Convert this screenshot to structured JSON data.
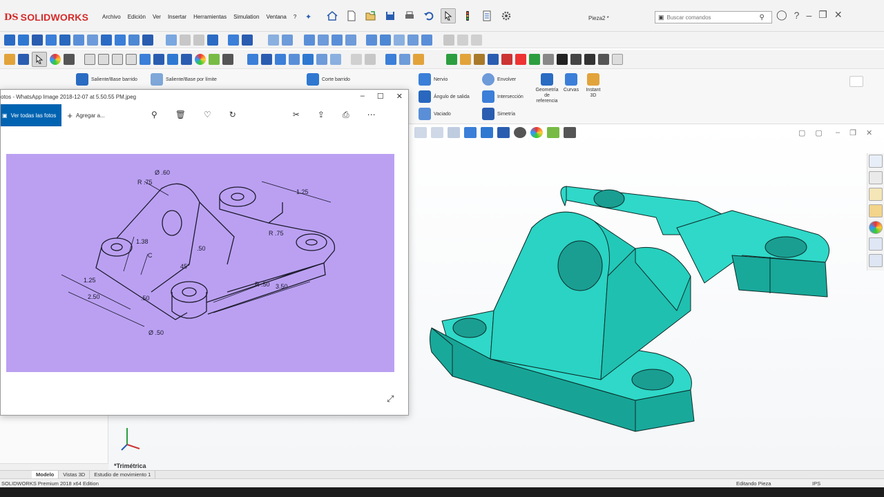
{
  "app": {
    "logo_ds": "DS",
    "logo_text": "SOLIDWORKS",
    "document_name": "Pieza2 *"
  },
  "menu": [
    "Archivo",
    "Edición",
    "Ver",
    "Insertar",
    "Herramientas",
    "Simulation",
    "Ventana",
    "?"
  ],
  "search": {
    "placeholder": "Buscar comandos"
  },
  "command_manager": {
    "saliente_barrido": "Saliente/Base barrido",
    "saliente_limite": "Saliente/Base por límite",
    "corte_barrido": "Corte barrido",
    "nervio": "Nervio",
    "angulo_salida": "Ángulo de salida",
    "vaciado": "Vaciado",
    "envolver": "Envolver",
    "interseccion": "Intersección",
    "simetria": "Simetría",
    "geometria_ref": [
      "Geometría",
      "de",
      "referencia"
    ],
    "curvas": "Curvas",
    "instant3d": [
      "Instant",
      "3D"
    ]
  },
  "photos": {
    "title": "otos - WhatsApp Image 2018-12-07 at 5.50.55 PM.jpeg",
    "see_all": "Ver todas las fotos",
    "add_to": "Agregar a...",
    "drawing_labels": {
      "d60": "Ø .60",
      "r75": "R .75",
      "d125": "1.25",
      "d138": "1.38",
      "d50a": ".50",
      "d45": "45°",
      "dc": "C",
      "r75b": "R .75",
      "d125b": "1.25",
      "d250": "2.50",
      "d50b": ".50",
      "r50": "R .50",
      "d350": "3.50",
      "d50c": "Ø .50"
    }
  },
  "view": {
    "orientation": "*Trimétrica"
  },
  "tabs": [
    "Modelo",
    "Vistas 3D",
    "Estudio de movimiento 1"
  ],
  "status": {
    "edition": "SOLIDWORKS Premium 2018 x64 Edition",
    "editing": "Editando Pieza",
    "units": "IPS"
  },
  "colors": {
    "part": "#2fd8c8",
    "part_dark": "#1a9e92",
    "photo_bg": "#bba0f2",
    "accent": "#0063b1",
    "brand": "#d42b2b"
  }
}
